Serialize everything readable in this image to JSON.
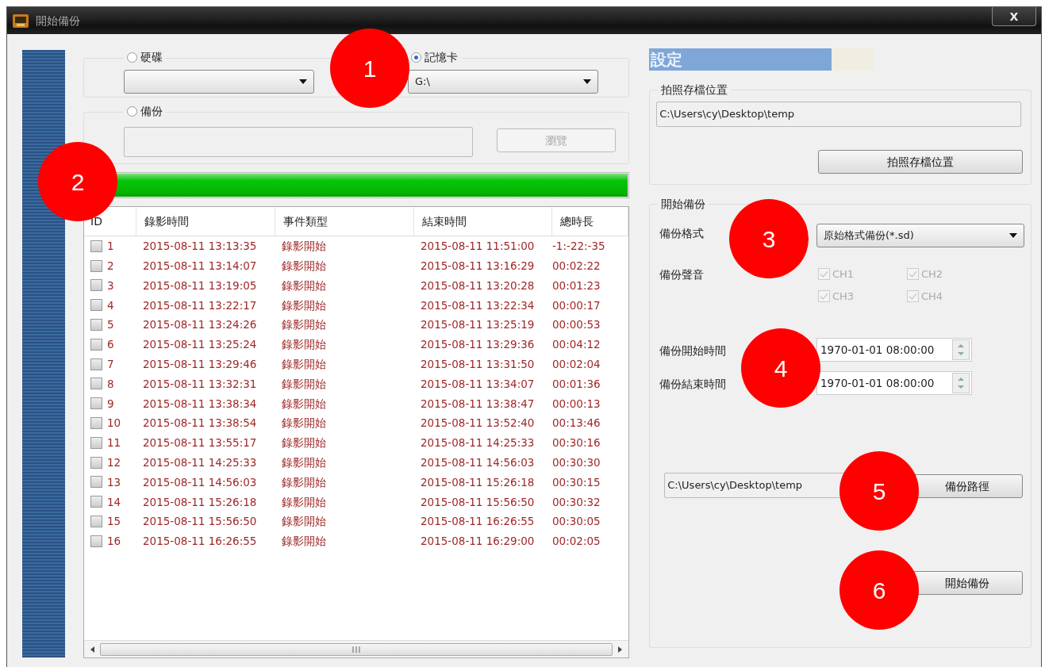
{
  "window": {
    "title": "開始備份",
    "close": "X"
  },
  "source": {
    "options": [
      {
        "label": "硬碟",
        "selected": false
      },
      {
        "label": "記憶卡",
        "selected": true,
        "value": "G:\\"
      }
    ],
    "backup": {
      "label": "備份",
      "selected": false,
      "browse": "瀏覽"
    }
  },
  "progress": {
    "level": 1
  },
  "table": {
    "columns": [
      "ID",
      "錄影時間",
      "事件類型",
      "結束時間",
      "總時長"
    ],
    "rows": [
      {
        "id": "1",
        "start": "2015-08-11 13:13:35",
        "event": "錄影開始",
        "end": "2015-08-11 11:51:00",
        "duration": "-1:-22:-35",
        "checked": false
      },
      {
        "id": "2",
        "start": "2015-08-11 13:14:07",
        "event": "錄影開始",
        "end": "2015-08-11 13:16:29",
        "duration": "00:02:22",
        "checked": false
      },
      {
        "id": "3",
        "start": "2015-08-11 13:19:05",
        "event": "錄影開始",
        "end": "2015-08-11 13:20:28",
        "duration": "00:01:23",
        "checked": false
      },
      {
        "id": "4",
        "start": "2015-08-11 13:22:17",
        "event": "錄影開始",
        "end": "2015-08-11 13:22:34",
        "duration": "00:00:17",
        "checked": false
      },
      {
        "id": "5",
        "start": "2015-08-11 13:24:26",
        "event": "錄影開始",
        "end": "2015-08-11 13:25:19",
        "duration": "00:00:53",
        "checked": false
      },
      {
        "id": "6",
        "start": "2015-08-11 13:25:24",
        "event": "錄影開始",
        "end": "2015-08-11 13:29:36",
        "duration": "00:04:12",
        "checked": false
      },
      {
        "id": "7",
        "start": "2015-08-11 13:29:46",
        "event": "錄影開始",
        "end": "2015-08-11 13:31:50",
        "duration": "00:02:04",
        "checked": false
      },
      {
        "id": "8",
        "start": "2015-08-11 13:32:31",
        "event": "錄影開始",
        "end": "2015-08-11 13:34:07",
        "duration": "00:01:36",
        "checked": false
      },
      {
        "id": "9",
        "start": "2015-08-11 13:38:34",
        "event": "錄影開始",
        "end": "2015-08-11 13:38:47",
        "duration": "00:00:13",
        "checked": false
      },
      {
        "id": "10",
        "start": "2015-08-11 13:38:54",
        "event": "錄影開始",
        "end": "2015-08-11 13:52:40",
        "duration": "00:13:46",
        "checked": false
      },
      {
        "id": "11",
        "start": "2015-08-11 13:55:17",
        "event": "錄影開始",
        "end": "2015-08-11 14:25:33",
        "duration": "00:30:16",
        "checked": false
      },
      {
        "id": "12",
        "start": "2015-08-11 14:25:33",
        "event": "錄影開始",
        "end": "2015-08-11 14:56:03",
        "duration": "00:30:30",
        "checked": false
      },
      {
        "id": "13",
        "start": "2015-08-11 14:56:03",
        "event": "錄影開始",
        "end": "2015-08-11 15:26:18",
        "duration": "00:30:15",
        "checked": false
      },
      {
        "id": "14",
        "start": "2015-08-11 15:26:18",
        "event": "錄影開始",
        "end": "2015-08-11 15:56:50",
        "duration": "00:30:32",
        "checked": false
      },
      {
        "id": "15",
        "start": "2015-08-11 15:56:50",
        "event": "錄影開始",
        "end": "2015-08-11 16:26:55",
        "duration": "00:30:05",
        "checked": false
      },
      {
        "id": "16",
        "start": "2015-08-11 16:26:55",
        "event": "錄影開始",
        "end": "2015-08-11 16:29:00",
        "duration": "00:02:05",
        "checked": false
      }
    ]
  },
  "settings": {
    "title": "設定",
    "snapshot": {
      "legend": "拍照存檔位置",
      "path": "C:\\Users\\cy\\Desktop\\temp",
      "button": "拍照存檔位置"
    },
    "backup": {
      "legend": "開始備份",
      "format_label": "備份格式",
      "format": "原始格式備份(*.sd)",
      "audio_label": "備份聲音",
      "channels": [
        {
          "label": "CH1",
          "checked": true,
          "disabled": true
        },
        {
          "label": "CH2",
          "checked": true,
          "disabled": true
        },
        {
          "label": "CH3",
          "checked": true,
          "disabled": true
        },
        {
          "label": "CH4",
          "checked": true,
          "disabled": true
        }
      ],
      "start_label": "備份開始時間",
      "start": "1970-01-01 08:00:00",
      "end_label": "備份結束時間",
      "end": "1970-01-01 08:00:00",
      "path": "C:\\Users\\cy\\Desktop\\temp",
      "path_button": "備份路徑",
      "start_button": "開始備份"
    }
  },
  "callouts": [
    "1",
    "2",
    "3",
    "4",
    "5",
    "6"
  ]
}
